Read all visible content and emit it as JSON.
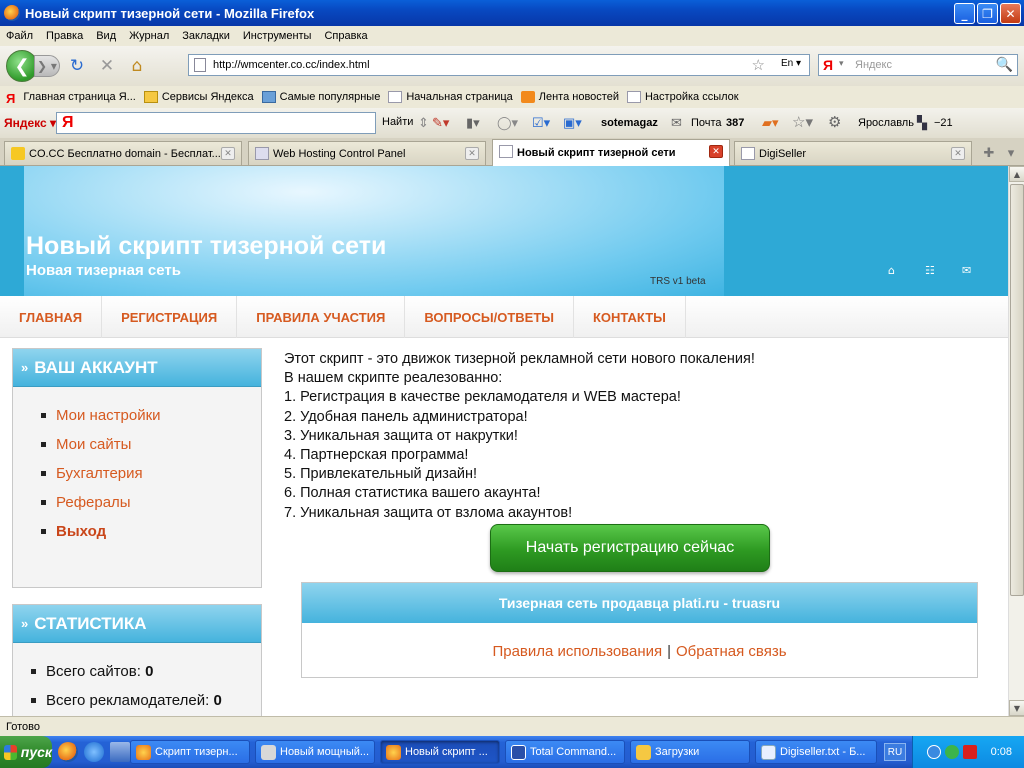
{
  "window": {
    "title": "Новый скрипт тизерной сети - Mozilla Firefox"
  },
  "menu": [
    "Файл",
    "Правка",
    "Вид",
    "Журнал",
    "Закладки",
    "Инструменты",
    "Справка"
  ],
  "nav": {
    "url": "http://wmcenter.co.cc/index.html",
    "search_placeholder": "Яндекс"
  },
  "bookmarks": [
    {
      "label": "Главная страница Я...",
      "icon": "yandex-icon"
    },
    {
      "label": "Сервисы Яндекса",
      "icon": "folder-icon"
    },
    {
      "label": "Самые популярные",
      "icon": "picture-icon"
    },
    {
      "label": "Начальная страница",
      "icon": "page-icon"
    },
    {
      "label": "Лента новостей",
      "icon": "rss-icon"
    },
    {
      "label": "Настройка ссылок",
      "icon": "page-icon"
    }
  ],
  "yabar": {
    "logo": "Яндекс",
    "find": "Найти",
    "user": "sotemagaz",
    "mail": "Почта",
    "mail_count": "387",
    "city": "Ярославль",
    "temp": "−21"
  },
  "tabs": [
    {
      "label": "CO.CC Бесплатно domain - Бесплат..."
    },
    {
      "label": "Web Hosting Control Panel"
    },
    {
      "label": "Новый скрипт тизерной сети"
    },
    {
      "label": "DigiSeller"
    }
  ],
  "page": {
    "banner_title": "Новый скрипт тизерной сети",
    "banner_subtitle": "Новая тизерная сеть",
    "version": "TRS v1 beta",
    "topnav": [
      "ГЛАВНАЯ",
      "РЕГИСТРАЦИЯ",
      "ПРАВИЛА УЧАСТИЯ",
      "ВОПРОСЫ/ОТВЕТЫ",
      "КОНТАКТЫ"
    ],
    "account": {
      "title": "ВАШ АККАУНТ",
      "items": [
        "Мои настройки",
        "Мои сайты",
        "Бухгалтерия",
        "Рефералы",
        "Выход"
      ]
    },
    "stats": {
      "title": "СТАТИСТИКА",
      "items": [
        {
          "label": "Всего сайтов:",
          "value": "0"
        },
        {
          "label": "Всего рекламодателей:",
          "value": "0"
        }
      ]
    },
    "intro": [
      "Этот скрипт - это движок тизерной рекламной сети нового покаления!",
      "В нашем скрипте реалезованно:",
      "1. Регистрация в качестве рекламодателя и WEB мастера!",
      "2. Удобная панель администратора!",
      "3. Уникальная защита от накрутки!",
      "4. Партнерская программа!",
      "5. Привлекательный дизайн!",
      "6. Полная статистика вашего акаунта!",
      "7. Уникальная защита от взлома акаунтов!"
    ],
    "register_button": "Начать регистрацию сейчас",
    "info_title": "Тизерная сеть продавца plati.ru - truasru",
    "info_link1": "Правила использования",
    "info_sep": "|",
    "info_link2": "Обратная связь"
  },
  "status": "Готово",
  "taskbar": {
    "start": "пуск",
    "tasks": [
      {
        "label": "Скрипт тизерн..."
      },
      {
        "label": "Новый мощный..."
      },
      {
        "label": "Новый скрипт ..."
      },
      {
        "label": "Total Command..."
      },
      {
        "label": "Загрузки"
      },
      {
        "label": "Digiseller.txt - Б..."
      }
    ],
    "lang": "RU",
    "clock": "0:08"
  },
  "colors": {
    "accent": "#d65a20",
    "banner": "#2ea9d6",
    "button": "#2e9a22"
  }
}
